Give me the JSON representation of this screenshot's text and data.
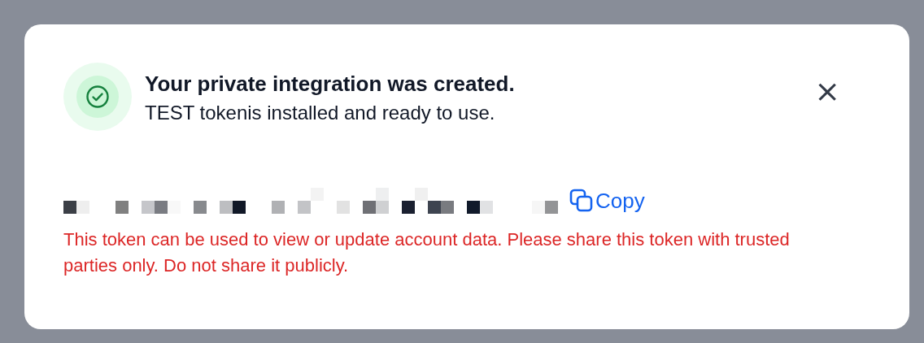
{
  "dialog": {
    "title": "Your private integration was created.",
    "subtitle": "TEST tokenis installed and ready to use.",
    "close_label": "×",
    "copy_label": "Copy",
    "warning": "This token can be used to view or update account data. Please share this token with trusted parties only. Do not share it publicly."
  }
}
